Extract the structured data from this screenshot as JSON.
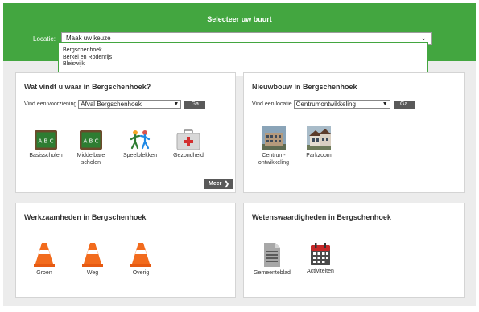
{
  "header": {
    "title": "Selecteer uw buurt",
    "location_label": "Locatie:",
    "location_value": "Maak uw keuze",
    "dropdown_options": [
      "Bergschenhoek",
      "Berkel en Rodenrijs",
      "Bleiswijk"
    ]
  },
  "panels": {
    "where": {
      "title": "Wat vindt u waar in Bergschenhoek?",
      "finder_label": "Vind een voorziening",
      "finder_value": "Afval Bergschenhoek",
      "go_label": "Ga",
      "tiles": [
        {
          "label": "Basisscholen",
          "icon": "chalkboard-icon"
        },
        {
          "label": "Middelbare scholen",
          "icon": "chalkboard-icon"
        },
        {
          "label": "Speelplekken",
          "icon": "children-playing-icon"
        },
        {
          "label": "Gezondheid",
          "icon": "first-aid-kit-icon"
        }
      ],
      "more_label": "Meer"
    },
    "nieuwbouw": {
      "title": "Nieuwbouw in Bergschenhoek",
      "finder_label": "Vind een locatie",
      "finder_value": "Centrumontwikkeling",
      "go_label": "Ga",
      "tiles": [
        {
          "label": "Centrum-ontwikkeling",
          "icon": "building-photo-icon"
        },
        {
          "label": "Parkzoom",
          "icon": "building-photo-icon"
        }
      ]
    },
    "werkzaamheden": {
      "title": "Werkzaamheden in Bergschenhoek",
      "tiles": [
        {
          "label": "Groen",
          "icon": "traffic-cone-icon"
        },
        {
          "label": "Weg",
          "icon": "traffic-cone-icon"
        },
        {
          "label": "Overig",
          "icon": "traffic-cone-icon"
        }
      ]
    },
    "wetenswaardigheden": {
      "title": "Wetenswaardigheden in Bergschenhoek",
      "tiles": [
        {
          "label": "Gemeenteblad",
          "icon": "document-icon"
        },
        {
          "label": "Activiteiten",
          "icon": "calendar-icon"
        }
      ]
    }
  },
  "colors": {
    "brand_green": "#43a640",
    "button_gray": "#595959",
    "cone_orange": "#f26b1d",
    "chalkboard_green": "#2e7d32",
    "calendar_red": "#c62828"
  }
}
